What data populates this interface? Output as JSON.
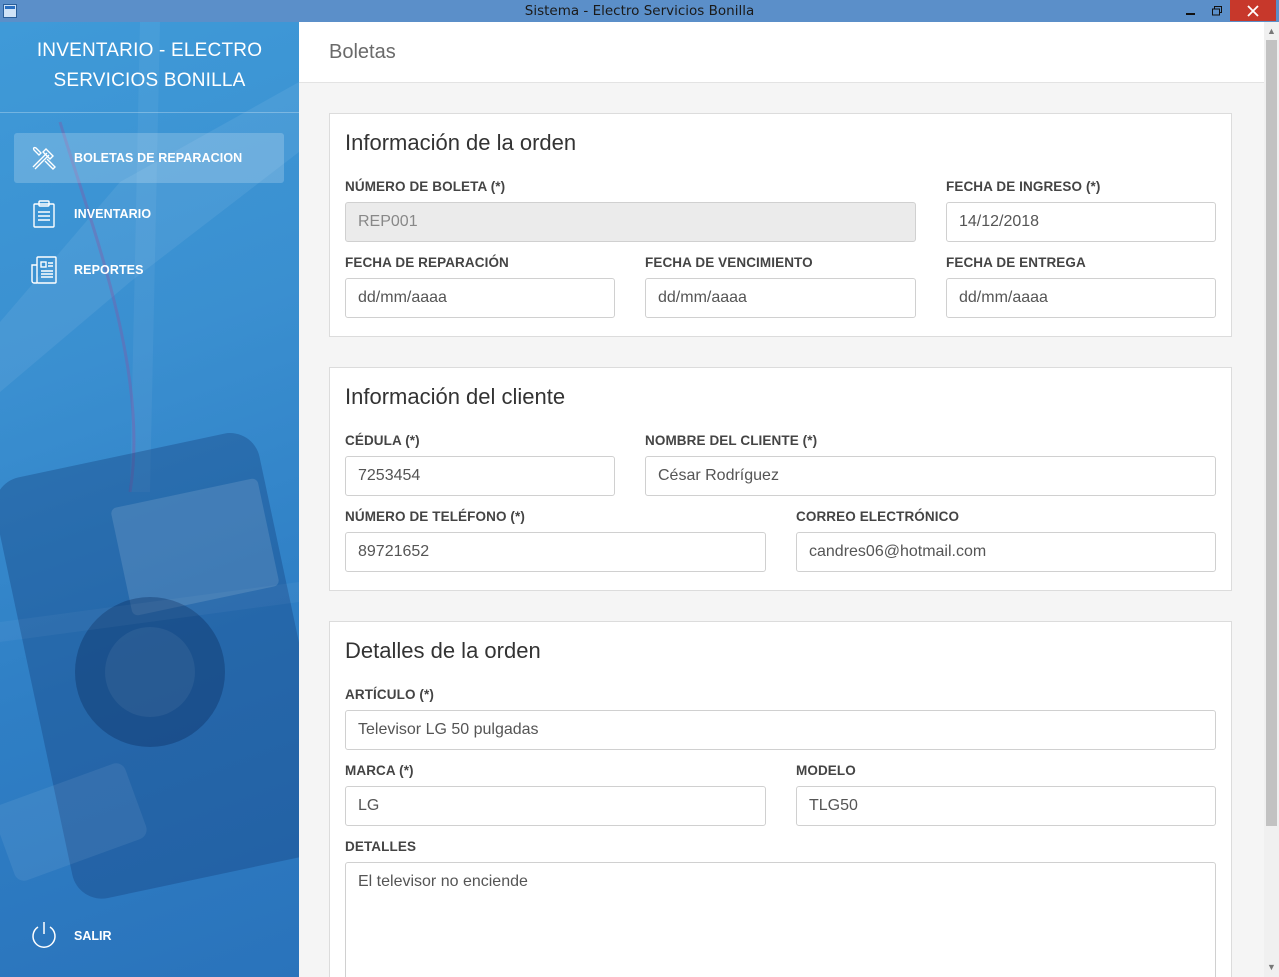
{
  "window": {
    "title": "Sistema - Electro Servicios Bonilla"
  },
  "sidebar": {
    "brand": "INVENTARIO - ELECTRO SERVICIOS BONILLA",
    "items": [
      {
        "label": "BOLETAS DE REPARACION",
        "icon": "tools-icon",
        "active": true
      },
      {
        "label": "INVENTARIO",
        "icon": "clipboard-icon",
        "active": false
      },
      {
        "label": "REPORTES",
        "icon": "report-icon",
        "active": false
      }
    ],
    "logout_label": "SALIR"
  },
  "header": {
    "title": "Boletas"
  },
  "orden": {
    "title": "Información de la orden",
    "numero_label": "NÚMERO DE BOLETA (*)",
    "numero_value": "REP001",
    "ingreso_label": "FECHA DE INGRESO (*)",
    "ingreso_value": "14/12/2018",
    "reparacion_label": "FECHA DE REPARACIÓN",
    "reparacion_value": "dd/mm/aaaa",
    "vencimiento_label": "FECHA DE VENCIMIENTO",
    "vencimiento_value": "dd/mm/aaaa",
    "entrega_label": "FECHA DE ENTREGA",
    "entrega_value": "dd/mm/aaaa"
  },
  "cliente": {
    "title": "Información del cliente",
    "cedula_label": "CÉDULA (*)",
    "cedula_value": "7253454",
    "nombre_label": "NOMBRE DEL CLIENTE (*)",
    "nombre_value": "César Rodríguez",
    "telefono_label": "NÚMERO DE TELÉFONO (*)",
    "telefono_value": "89721652",
    "correo_label": "CORREO ELECTRÓNICO",
    "correo_value": "candres06@hotmail.com"
  },
  "detalles": {
    "title": "Detalles de la orden",
    "articulo_label": "ARTÍCULO (*)",
    "articulo_value": "Televisor LG 50 pulgadas",
    "marca_label": "MARCA (*)",
    "marca_value": "LG",
    "modelo_label": "MODELO",
    "modelo_value": "TLG50",
    "detalles_label": "DETALLES",
    "detalles_value": "El televisor no enciende"
  },
  "colors": {
    "sidebar": "#3a8fd0",
    "titlebar": "#5b8fc9",
    "close": "#c7382b"
  }
}
